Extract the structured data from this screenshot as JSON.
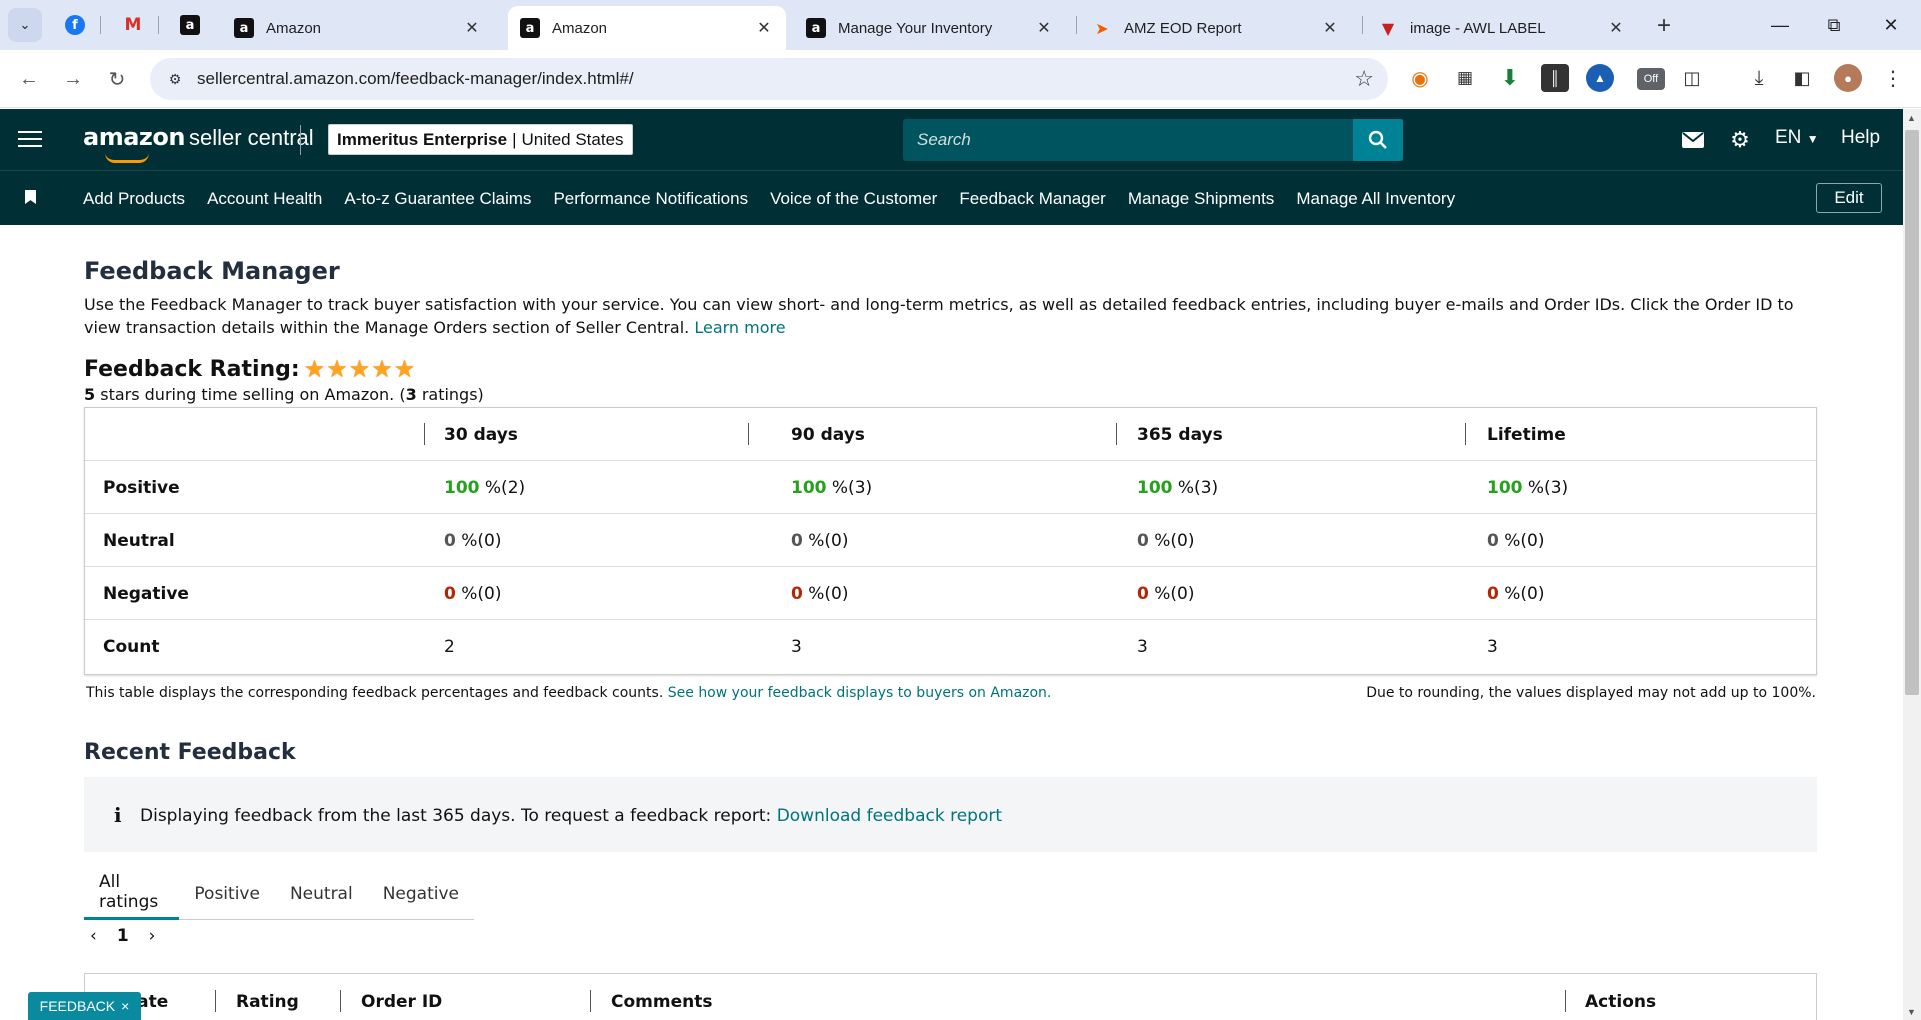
{
  "browser": {
    "tabs": [
      {
        "title": "Amazon",
        "icon": "amazon-icon"
      },
      {
        "title": "Amazon",
        "icon": "amazon-icon",
        "active": true
      },
      {
        "title": "Manage Your Inventory",
        "icon": "amazon-icon"
      },
      {
        "title": "AMZ EOD Report",
        "icon": "eod-report-icon"
      },
      {
        "title": "image - AWL LABEL",
        "icon": "red-v-icon"
      }
    ],
    "url": "sellercentral.amazon.com/feedback-manager/index.html#/",
    "extension_badge": "Off"
  },
  "header": {
    "logo_brand": "amazon",
    "logo_product": "seller central",
    "account_name": "Immeritus Enterprise",
    "account_region": "United States",
    "search_placeholder": "Search",
    "language": "EN",
    "help": "Help"
  },
  "nav": {
    "links": [
      "Add Products",
      "Account Health",
      "A-to-z Guarantee Claims",
      "Performance Notifications",
      "Voice of the Customer",
      "Feedback Manager",
      "Manage Shipments",
      "Manage All Inventory"
    ],
    "edit": "Edit"
  },
  "page": {
    "title": "Feedback Manager",
    "intro": "Use the Feedback Manager to track buyer satisfaction with your service. You can view short- and long-term metrics, as well as detailed feedback entries, including buyer e-mails and Order IDs. Click the Order ID to view transaction details within the Manage Orders section of Seller Central.",
    "learn_more": "Learn more",
    "rating_title": "Feedback Rating:",
    "star_count": 5,
    "stars_value": "5",
    "stars_text": "stars during time selling on Amazon. (",
    "ratings_count": "3",
    "ratings_suffix": "ratings)"
  },
  "metrics": {
    "columns": [
      "30 days",
      "90 days",
      "365 days",
      "Lifetime"
    ],
    "rows": [
      {
        "label": "Positive",
        "values": [
          {
            "pct": "100",
            "count": "%(2)"
          },
          {
            "pct": "100",
            "count": "%(3)"
          },
          {
            "pct": "100",
            "count": "%(3)"
          },
          {
            "pct": "100",
            "count": "%(3)"
          }
        ]
      },
      {
        "label": "Neutral",
        "values": [
          {
            "pct": "0",
            "count": "%(0)"
          },
          {
            "pct": "0",
            "count": "%(0)"
          },
          {
            "pct": "0",
            "count": "%(0)"
          },
          {
            "pct": "0",
            "count": "%(0)"
          }
        ]
      },
      {
        "label": "Negative",
        "values": [
          {
            "pct": "0",
            "count": "%(0)"
          },
          {
            "pct": "0",
            "count": "%(0)"
          },
          {
            "pct": "0",
            "count": "%(0)"
          },
          {
            "pct": "0",
            "count": "%(0)"
          }
        ]
      },
      {
        "label": "Count",
        "values": [
          "2",
          "3",
          "3",
          "3"
        ]
      }
    ],
    "note_left": "This table displays the corresponding feedback percentages and feedback counts.",
    "note_link": "See how your feedback displays to buyers on Amazon.",
    "note_right": "Due to rounding, the values displayed may not add up to 100%."
  },
  "recent": {
    "title": "Recent Feedback",
    "info_text": "Displaying feedback from the last 365 days. To request a feedback report:",
    "info_link": "Download feedback report",
    "tabs": [
      "All ratings",
      "Positive",
      "Neutral",
      "Negative"
    ],
    "page": "1",
    "columns": [
      "Date",
      "Rating",
      "Order ID",
      "Comments",
      "Actions"
    ]
  },
  "feedback_tab": {
    "label": "FEEDBACK",
    "close": "×"
  },
  "colors": {
    "header_bg": "#002f36",
    "accent": "#008296",
    "positive": "#26a11d",
    "negative": "#b12704",
    "star": "#ffa41c"
  }
}
